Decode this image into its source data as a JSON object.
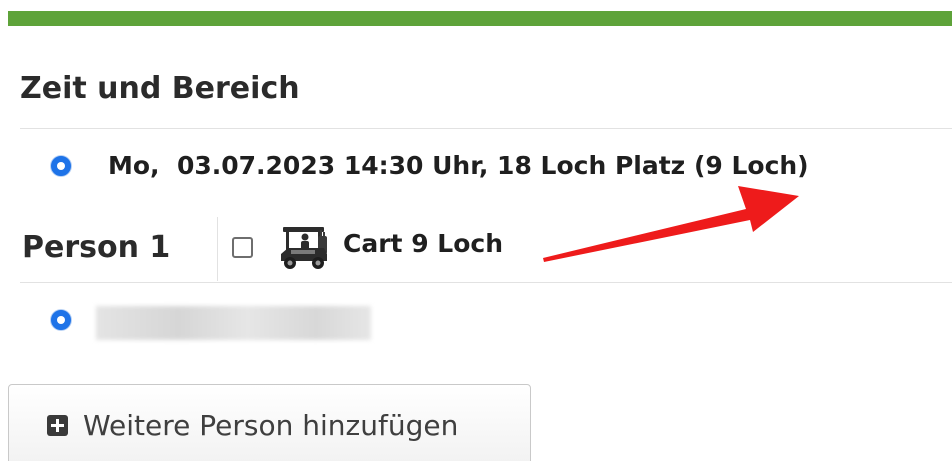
{
  "colors": {
    "accent_bar": "#5ea33a",
    "radio_selected": "#1e73e8",
    "annotation_arrow": "#ee1b1b"
  },
  "section": {
    "title": "Zeit und Bereich"
  },
  "booking": {
    "slot_label": "Mo,  03.07.2023 14:30 Uhr, 18 Loch Platz (9 Loch)",
    "slot_selected": true
  },
  "person": {
    "label": "Person 1",
    "cart_label": "Cart 9 Loch",
    "cart_checked": false,
    "cart_icon": "golf-cart-icon",
    "player_selected": true
  },
  "actions": {
    "add_person_label": "Weitere Person hinzufügen",
    "add_person_icon": "plus-square-icon"
  }
}
